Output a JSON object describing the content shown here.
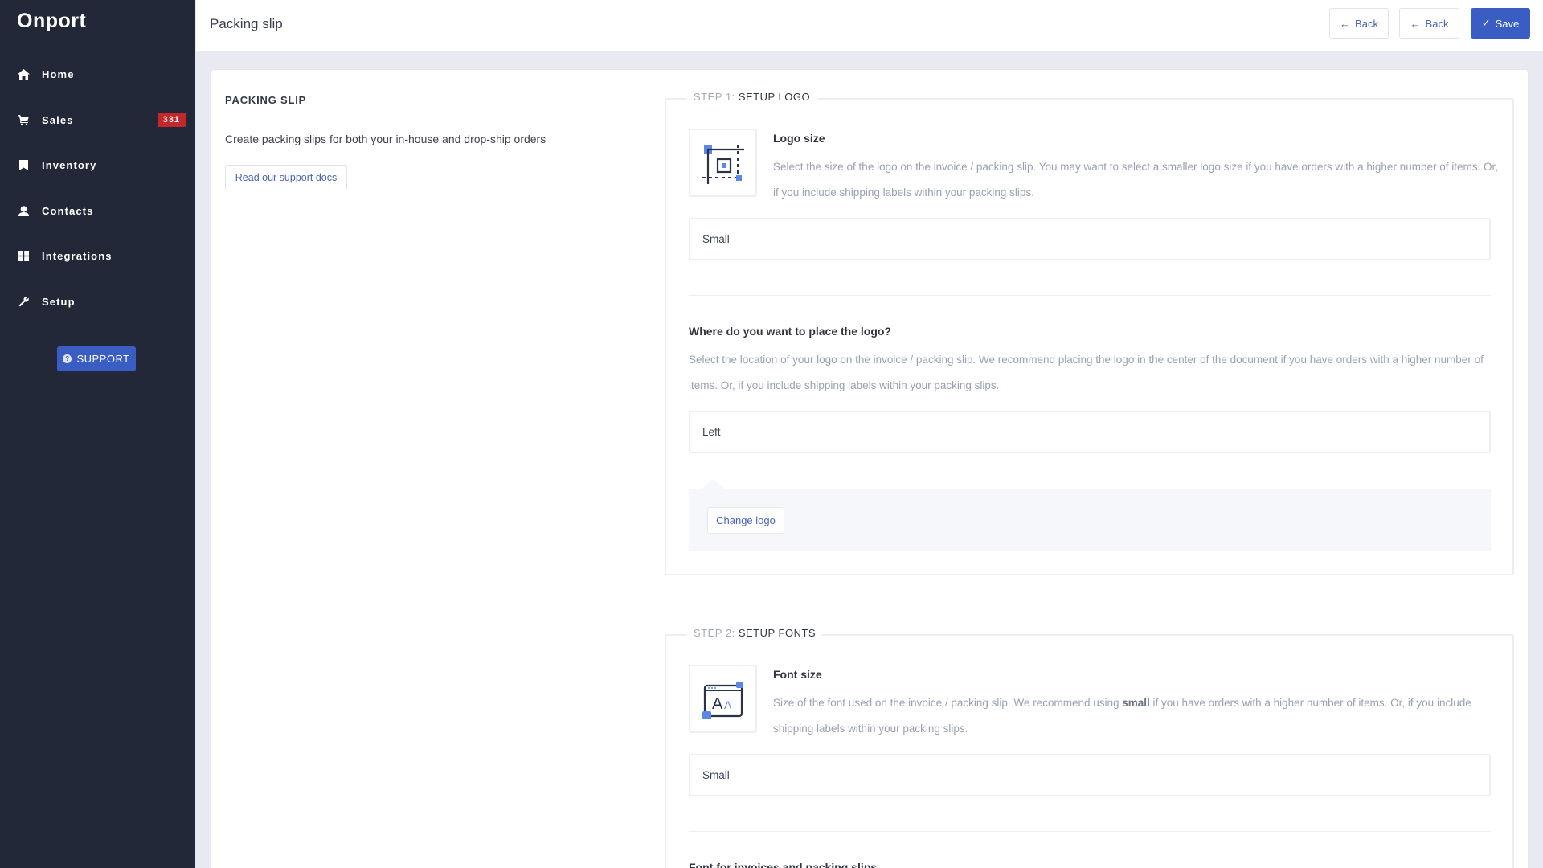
{
  "app": {
    "name": "Onport"
  },
  "sidebar": {
    "items": [
      {
        "label": "Home",
        "icon": "home-icon"
      },
      {
        "label": "Sales",
        "icon": "cart-icon",
        "badge": "331"
      },
      {
        "label": "Inventory",
        "icon": "bookmark-icon"
      },
      {
        "label": "Contacts",
        "icon": "user-icon"
      },
      {
        "label": "Integrations",
        "icon": "grid-icon"
      },
      {
        "label": "Setup",
        "icon": "wrench-icon"
      }
    ],
    "support_label": "SUPPORT"
  },
  "header": {
    "title": "Packing slip",
    "back_label_1": "Back",
    "back_label_2": "Back",
    "save_label": "Save"
  },
  "intro": {
    "heading": "PACKING SLIP",
    "description": "Create packing slips for both your in-house and drop-ship orders",
    "docs_button": "Read our support docs"
  },
  "step1": {
    "number": "STEP 1:",
    "name": "SETUP LOGO",
    "logo_size": {
      "title": "Logo size",
      "description": "Select the size of the logo on the invoice / packing slip. You may want to select a smaller logo size if you have orders with a higher number of items. Or, if you include shipping labels within your packing slips.",
      "value": "Small"
    },
    "logo_position": {
      "title": "Where do you want to place the logo?",
      "description": "Select the location of your logo on the invoice / packing slip. We recommend placing the logo in the center of the document if you have orders with a higher number of items. Or, if you include shipping labels within your packing slips.",
      "value": "Left"
    },
    "change_logo_label": "Change logo"
  },
  "step2": {
    "number": "STEP 2:",
    "name": "SETUP FONTS",
    "font_size": {
      "title": "Font size",
      "description_before": "Size of the font used on the invoice / packing slip. We recommend using ",
      "description_bold": "small",
      "description_after": " if you have orders with a higher number of items. Or, if you include shipping labels within your packing slips.",
      "value": "Small"
    },
    "font_family_title": "Font for invoices and packing slips"
  },
  "colors": {
    "sidebar_bg": "#222838",
    "accent": "#3a5dc4",
    "badge": "#c4272a",
    "link": "#4a63b8"
  }
}
